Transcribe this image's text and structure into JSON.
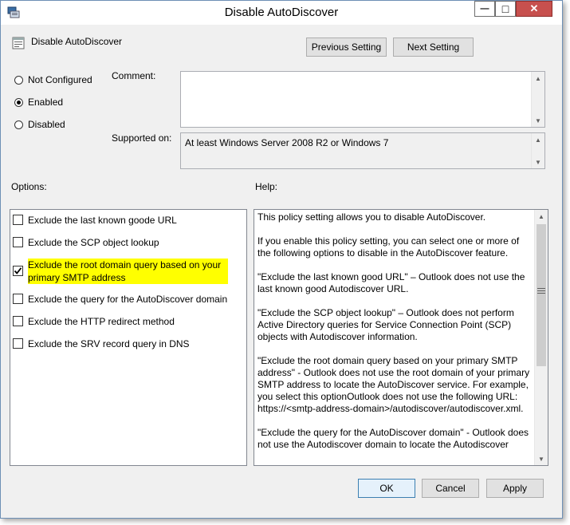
{
  "window": {
    "title": "Disable AutoDiscover",
    "close_glyph": "✕",
    "max_glyph": "□",
    "min_glyph": "—"
  },
  "setting": {
    "name": "Disable AutoDiscover"
  },
  "nav": {
    "previous_label": "Previous Setting",
    "next_label": "Next Setting"
  },
  "state": {
    "options": [
      {
        "label": "Not Configured",
        "selected": false
      },
      {
        "label": "Enabled",
        "selected": true
      },
      {
        "label": "Disabled",
        "selected": false
      }
    ]
  },
  "comment": {
    "label": "Comment:",
    "value": ""
  },
  "supported": {
    "label": "Supported on:",
    "value": "At least Windows Server 2008 R2 or Windows 7"
  },
  "options_panel": {
    "label": "Options:",
    "items": [
      {
        "label": "Exclude the last known goode URL",
        "checked": false
      },
      {
        "label": "Exclude the SCP object lookup",
        "checked": false
      },
      {
        "label": "Exclude the root domain query based on your primary SMTP address",
        "checked": true,
        "highlight": "#ffff00"
      },
      {
        "label": "Exclude the query for the AutoDiscover domain",
        "checked": false
      },
      {
        "label": "Exclude the HTTP redirect method",
        "checked": false
      },
      {
        "label": "Exclude the SRV record query in DNS",
        "checked": false
      }
    ]
  },
  "help_panel": {
    "label": "Help:",
    "paragraphs": [
      "This policy setting allows you to disable AutoDiscover.",
      "If you enable this policy setting, you can select one or more of the following options to disable in the AutoDiscover feature.",
      "\"Exclude the last known good URL\" – Outlook does not use the last known good Autodiscover URL.",
      "\"Exclude the SCP object lookup\" – Outlook does not perform Active Directory queries for Service Connection Point (SCP) objects with Autodiscover information.",
      "\"Exclude the root domain query based on your primary SMTP address\" - Outlook does not use the root domain of your primary SMTP address to locate the AutoDiscover service. For example, you select this optionOutlook does not use the following URL: https://<smtp-address-domain>/autodiscover/autodiscover.xml.",
      "\"Exclude the query for the AutoDiscover domain\" - Outlook does not use the Autodiscover domain to locate the Autodiscover"
    ]
  },
  "footer": {
    "ok_label": "OK",
    "cancel_label": "Cancel",
    "apply_label": "Apply"
  },
  "colors": {
    "highlight": "#ffff00",
    "close_button": "#c7504e",
    "accent": "#3c7fb1"
  }
}
